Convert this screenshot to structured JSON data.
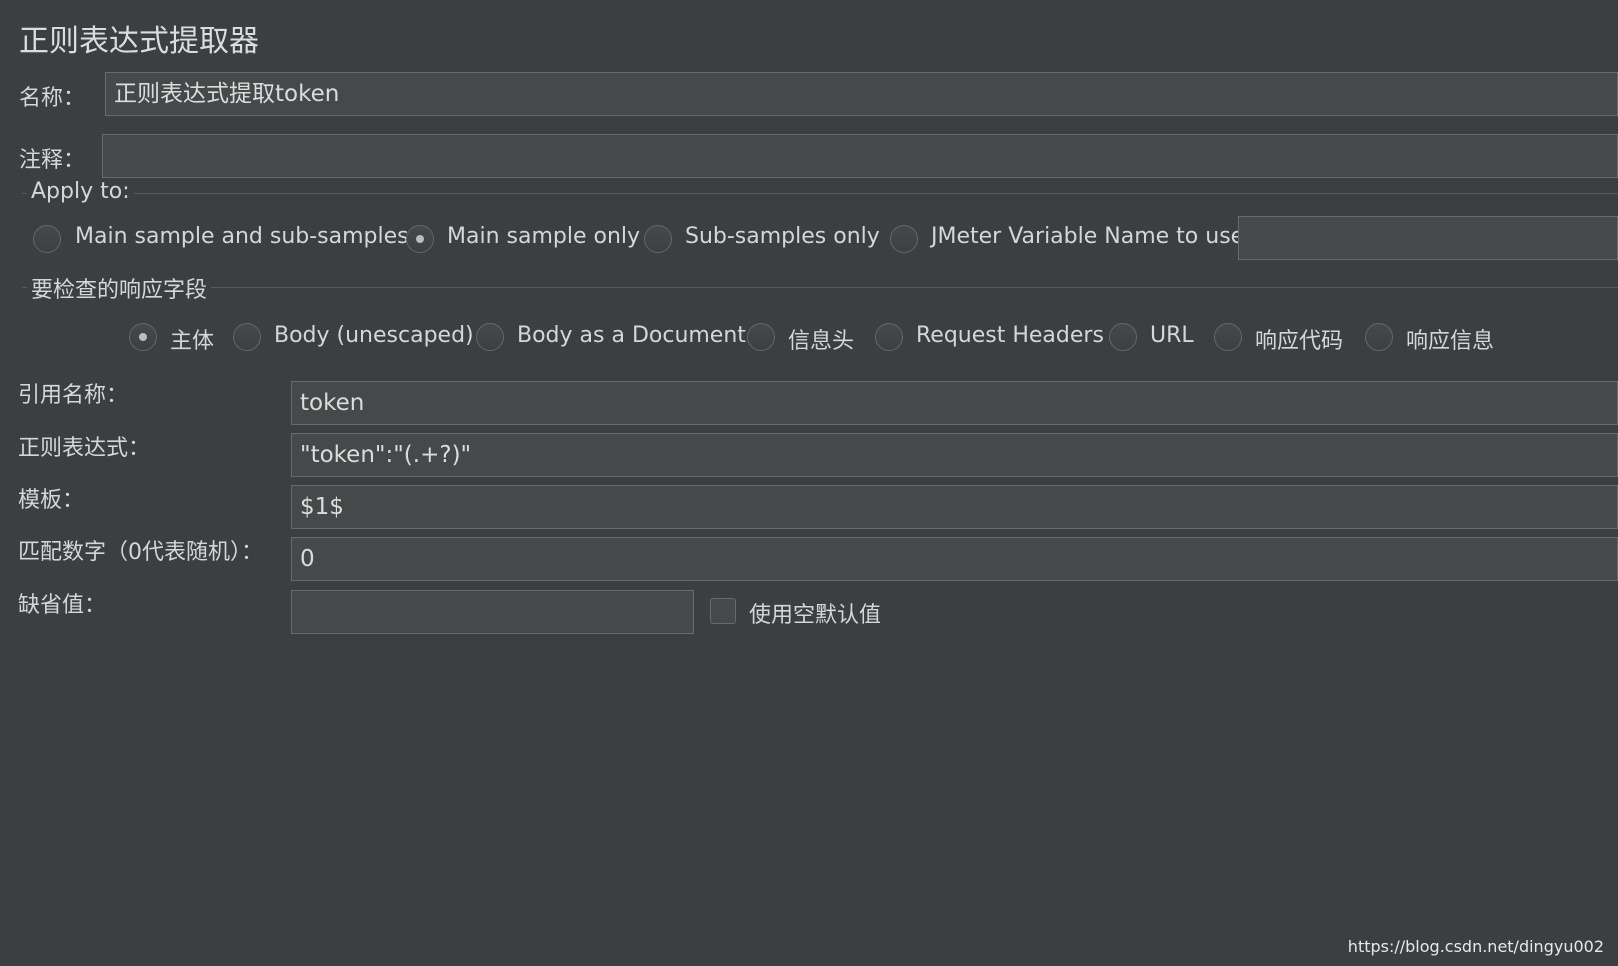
{
  "title": "正则表达式提取器",
  "name": {
    "label": "名称：",
    "value": "正则表达式提取token"
  },
  "comment": {
    "label": "注释：",
    "value": ""
  },
  "apply_to": {
    "title": "Apply to:",
    "options": [
      {
        "label": "Main sample and sub-samples",
        "selected": false
      },
      {
        "label": "Main sample only",
        "selected": true
      },
      {
        "label": "Sub-samples only",
        "selected": false
      },
      {
        "label": "JMeter Variable Name to use",
        "selected": false
      }
    ],
    "variable_value": ""
  },
  "field_to_check": {
    "title": "要检查的响应字段",
    "options": [
      {
        "label": "主体",
        "selected": true
      },
      {
        "label": "Body (unescaped)",
        "selected": false
      },
      {
        "label": "Body as a Document",
        "selected": false
      },
      {
        "label": "信息头",
        "selected": false
      },
      {
        "label": "Request Headers",
        "selected": false
      },
      {
        "label": "URL",
        "selected": false
      },
      {
        "label": "响应代码",
        "selected": false
      },
      {
        "label": "响应信息",
        "selected": false
      }
    ]
  },
  "ref_name": {
    "label": "引用名称：",
    "value": "token"
  },
  "regex": {
    "label": "正则表达式：",
    "value": "\"token\":\"(.+?)\""
  },
  "template": {
    "label": "模板：",
    "value": "$1$"
  },
  "match_no": {
    "label": "匹配数字（0代表随机）：",
    "value": "0"
  },
  "default_value": {
    "label": "缺省值：",
    "value": "",
    "use_empty_label": "使用空默认值",
    "use_empty_checked": false
  },
  "watermark": "https://blog.csdn.net/dingyu002"
}
